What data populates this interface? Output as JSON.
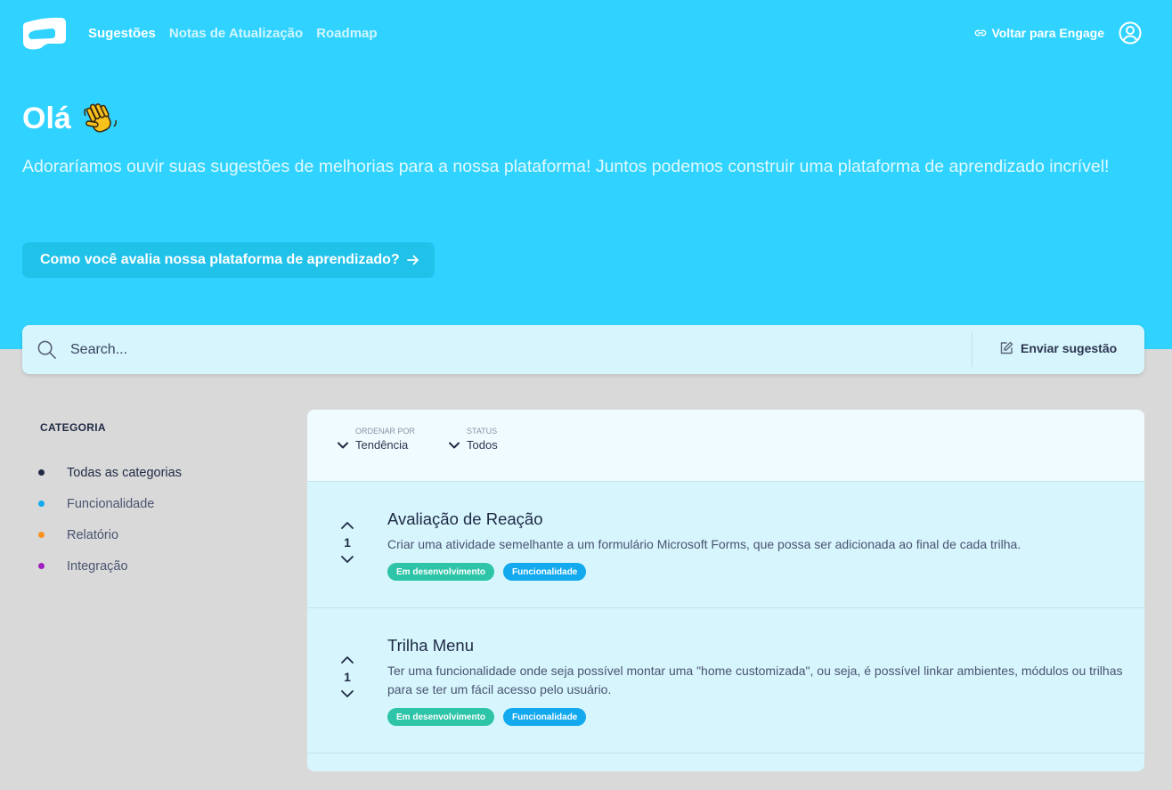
{
  "nav": {
    "items": [
      {
        "label": "Sugestões",
        "active": true
      },
      {
        "label": "Notas de Atualização",
        "active": false
      },
      {
        "label": "Roadmap",
        "active": false
      }
    ],
    "back_label": "Voltar para Engage"
  },
  "hero": {
    "greeting": "Olá",
    "intro": "Adoraríamos ouvir suas sugestões de melhorias para a nossa plataforma! Juntos podemos construir uma plataforma de aprendizado incrível!",
    "cta_label": "Como você avalia nossa plataforma de aprendizado?"
  },
  "search": {
    "placeholder": "Search...",
    "submit_label": "Enviar sugestão"
  },
  "sidebar": {
    "heading": "CATEGORIA",
    "items": [
      {
        "label": "Todas as categorias",
        "color": "#1f2a44",
        "active": true
      },
      {
        "label": "Funcionalidade",
        "color": "#12a9ee",
        "active": false
      },
      {
        "label": "Relatório",
        "color": "#f7931e",
        "active": false
      },
      {
        "label": "Integração",
        "color": "#a020c0",
        "active": false
      }
    ]
  },
  "filters": {
    "sort": {
      "label": "ORDENAR POR",
      "value": "Tendência"
    },
    "status": {
      "label": "STATUS",
      "value": "Todos"
    }
  },
  "posts": [
    {
      "title": "Avaliação de Reação",
      "description": "Criar uma atividade semelhante a um formulário Microsoft Forms, que possa ser adicionada ao final de cada trilha.",
      "votes": "1",
      "tags": [
        {
          "label": "Em desenvolvimento",
          "color": "#2ec4a8"
        },
        {
          "label": "Funcionalidade",
          "color": "#12a9ee"
        }
      ]
    },
    {
      "title": "Trilha Menu",
      "description": "Ter uma funcionalidade onde seja possível montar uma \"home customizada\", ou seja, é possível linkar ambientes, módulos ou trilhas para se ter um fácil acesso pelo usuário.",
      "votes": "1",
      "tags": [
        {
          "label": "Em desenvolvimento",
          "color": "#2ec4a8"
        },
        {
          "label": "Funcionalidade",
          "color": "#12a9ee"
        }
      ]
    }
  ],
  "colors": {
    "hero": "#30d3ff",
    "background": "#d9d9d9",
    "card": "#d6f5fd"
  }
}
